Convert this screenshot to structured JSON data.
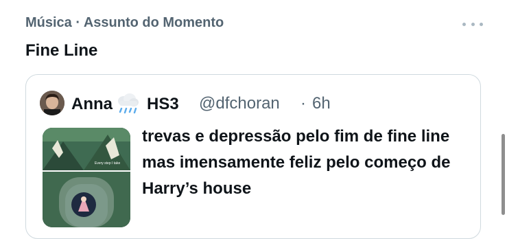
{
  "trend": {
    "context": "Música · Assunto do Momento",
    "title": "Fine Line"
  },
  "quote_tweet": {
    "display_name": "Anna",
    "display_name_suffix": "HS3",
    "emoji_icon": "cloud-rain-icon",
    "handle": "@dfchoran",
    "separator": "·",
    "time": "6h",
    "text": "trevas e depressão pelo fim de fine line mas imensamente feliz pelo começo de Harry’s house",
    "media_caption": "Every step I take"
  },
  "colors": {
    "primary_text": "#0f1419",
    "secondary_text": "#536471",
    "border": "#cfd9de"
  }
}
